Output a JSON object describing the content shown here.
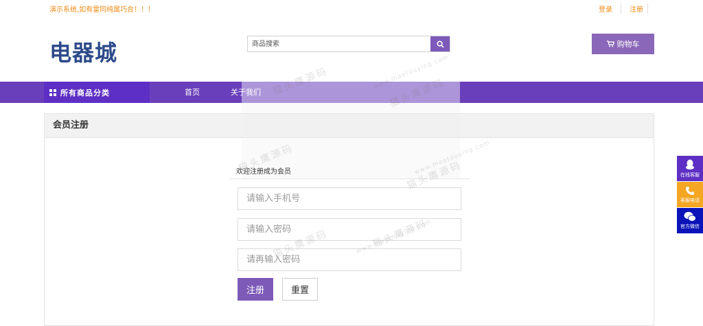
{
  "topbar": {
    "notice": "演示系统,如有雷同纯属巧合！！！",
    "login": "登录",
    "register": "注册"
  },
  "header": {
    "logo": "电器城",
    "search_placeholder": "商品搜索",
    "cart_label": "购物车"
  },
  "nav": {
    "category_label": "所有商品分类",
    "links": [
      "首页",
      "关于我们"
    ]
  },
  "panel": {
    "title": "会员注册",
    "welcome": "欢迎注册成为会员"
  },
  "form": {
    "phone_placeholder": "请输入手机号",
    "password_placeholder": "请输入密码",
    "confirm_placeholder": "请再输入密码",
    "submit_label": "注册",
    "reset_label": "重置"
  },
  "side": {
    "items": [
      {
        "label": "在线客服",
        "color": "#5d2fc4",
        "icon": "qq-icon"
      },
      {
        "label": "客服电话",
        "color": "#f5a623",
        "icon": "phone-icon"
      },
      {
        "label": "官方微信",
        "color": "#0a14b8",
        "icon": "wechat-icon"
      }
    ]
  },
  "watermark": {
    "url": "www.maotouying.com",
    "text": "猫头鹰源码"
  },
  "colors": {
    "accent": "#7d5ab8",
    "nav": "#6a3fbb",
    "nav_category": "#5d2fc4",
    "notice": "#f08c1a",
    "logo": "#2d4a8a"
  }
}
